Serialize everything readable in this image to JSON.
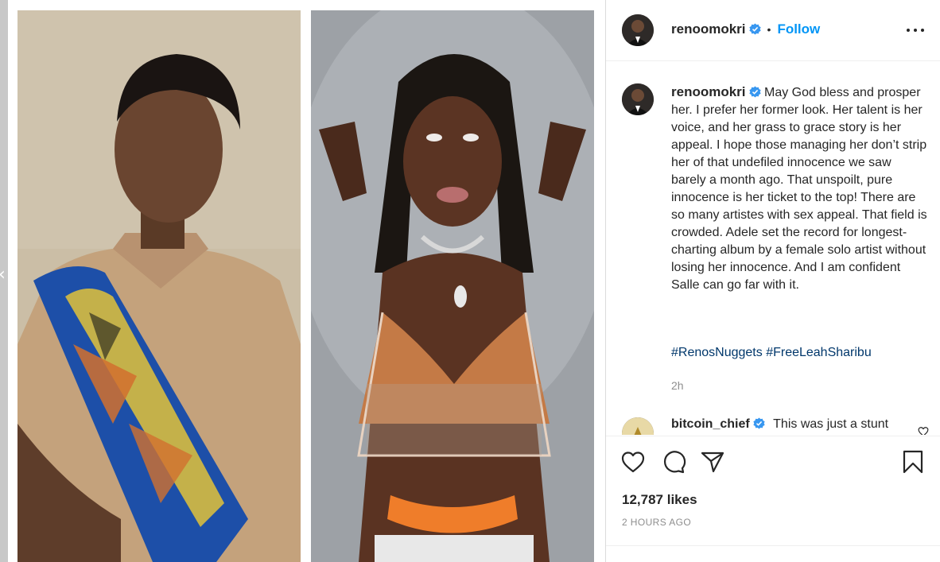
{
  "post": {
    "username": "renoomokri",
    "follow_label": "Follow",
    "separator": "•",
    "caption_text": "May God bless and prosper her. I prefer her former look. Her talent is her voice, and her grass to grace story is her appeal. I hope those managing her don’t strip her of that undefiled innocence we saw barely a month ago. That unspoilt, pure innocence is her ticket to the top! There are so many artistes with sex appeal. That field is crowded. Adele set the record for longest-charting album by a female solo artist without losing her innocence. And I am confident Salle can go far with it.",
    "hashtags": "#RenosNuggets #FreeLeahSharibu",
    "caption_time": "2h",
    "likes": "12,787 likes",
    "timestamp": "2 HOURS AGO"
  },
  "reply": {
    "username": "bitcoin_chief",
    "text": "This was just a stunt"
  },
  "colors": {
    "accent": "#0095f6",
    "verified": "#3897f0",
    "hashtag": "#00376b",
    "text": "#262626",
    "muted": "#8e8e8e"
  },
  "icons": {
    "like": "heart-icon",
    "comment": "comment-icon",
    "share": "paper-plane-icon",
    "save": "bookmark-icon",
    "more": "more-options-icon",
    "verified": "verified-badge-icon",
    "prev": "chevron-left-icon"
  }
}
